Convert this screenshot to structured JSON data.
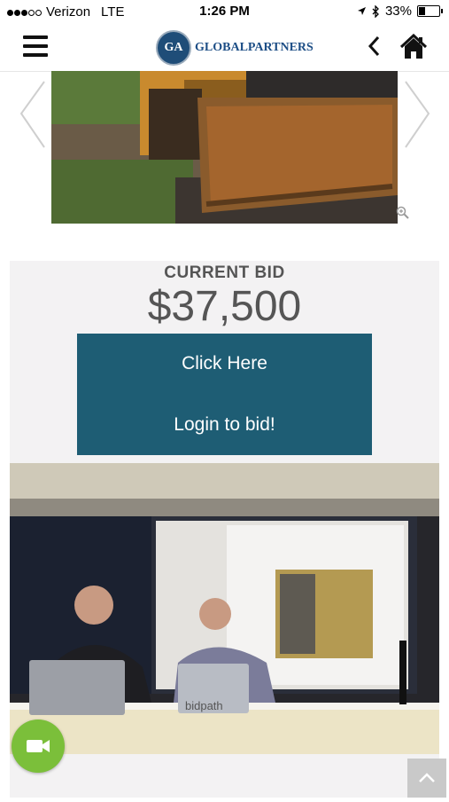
{
  "status_bar": {
    "carrier": "Verizon",
    "network": "LTE",
    "time": "1:26 PM",
    "battery_percent": "33%",
    "battery_level": 0.33
  },
  "header": {
    "logo_mark": "GA",
    "logo_text": "GLOBALPARTNERS",
    "icons": [
      "hamburger-menu-icon",
      "back-chevron-icon",
      "home-icon"
    ]
  },
  "gallery": {
    "icons": [
      "prev-arrow-icon",
      "next-arrow-icon",
      "zoom-icon"
    ]
  },
  "bid": {
    "title": "CURRENT BID",
    "amount": "$37,500",
    "button_line1": "Click Here",
    "button_line2": "Login to bid!",
    "button_color": "#1e5d74"
  },
  "video": {
    "laptop_label": "bidpath"
  },
  "floating": {
    "video_button_color": "#7bbf3a",
    "icons": [
      "video-camera-icon",
      "scroll-top-chevron-icon"
    ]
  }
}
